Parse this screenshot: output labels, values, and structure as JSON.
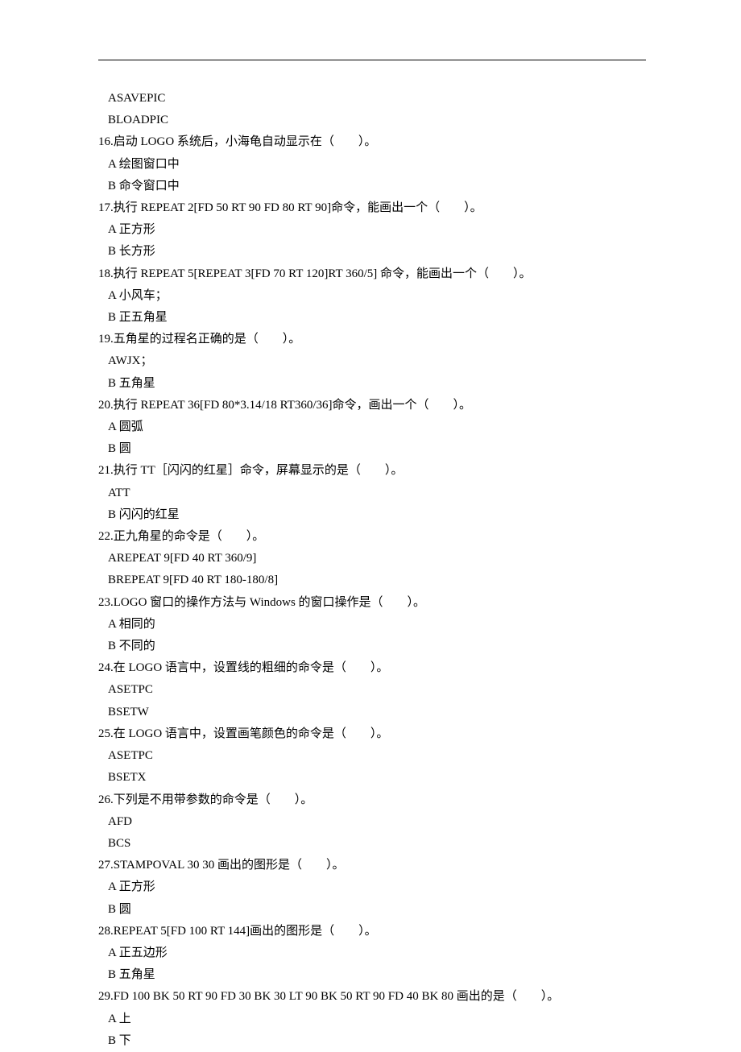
{
  "leadingOptions": [
    "ASAVEPIC",
    "BLOADPIC"
  ],
  "questions": [
    {
      "num": "16",
      "text": "启动 LOGO 系统后，小海龟自动显示在（　　）。",
      "options": [
        "A 绘图窗口中",
        "B 命令窗口中"
      ]
    },
    {
      "num": "17",
      "text": "执行 REPEAT 2[FD 50 RT 90 FD 80 RT 90]命令，能画出一个（　　）。",
      "options": [
        "A 正方形",
        "B 长方形"
      ]
    },
    {
      "num": "18",
      "text": "执行 REPEAT 5[REPEAT 3[FD 70 RT 120]RT 360/5]  命令，能画出一个（　　）。",
      "options": [
        "A 小风车；",
        "B 正五角星"
      ]
    },
    {
      "num": "19",
      "text": "五角星的过程名正确的是（　　）。",
      "options": [
        "AWJX；",
        "B 五角星"
      ]
    },
    {
      "num": "20",
      "text": "执行 REPEAT 36[FD 80*3.14/18 RT360/36]命令，画出一个（　　）。",
      "options": [
        "A 圆弧",
        "B 圆"
      ]
    },
    {
      "num": "21",
      "text": "执行 TT［闪闪的红星］命令，屏幕显示的是（　　）。",
      "options": [
        "ATT",
        "B 闪闪的红星"
      ]
    },
    {
      "num": "22",
      "text": "正九角星的命令是（　　）。",
      "options": [
        "AREPEAT 9[FD 40 RT 360/9]",
        "BREPEAT 9[FD 40 RT 180-180/8]"
      ]
    },
    {
      "num": "23",
      "text": "LOGO 窗口的操作方法与 Windows 的窗口操作是（　　）。",
      "options": [
        "A 相同的",
        "B 不同的"
      ]
    },
    {
      "num": "24",
      "text": "在 LOGO 语言中，设置线的粗细的命令是（　　）。",
      "options": [
        "ASETPC",
        "BSETW"
      ]
    },
    {
      "num": "25",
      "text": "在 LOGO 语言中，设置画笔颜色的命令是（　　）。",
      "options": [
        "ASETPC",
        "BSETX"
      ]
    },
    {
      "num": "26",
      "text": "下列是不用带参数的命令是（　　）。",
      "options": [
        "AFD",
        "BCS"
      ]
    },
    {
      "num": "27",
      "text": "STAMPOVAL 30 30 画出的图形是（　　）。",
      "options": [
        "A 正方形",
        "B 圆"
      ]
    },
    {
      "num": "28",
      "text": "REPEAT 5[FD 100 RT 144]画出的图形是（　　）。",
      "options": [
        "A 正五边形",
        "B 五角星"
      ]
    },
    {
      "num": "29",
      "text": "FD 100 BK 50 RT 90 FD 30 BK 30 LT 90 BK 50 RT 90 FD 40 BK 80 画出的是（　　）。",
      "options": [
        "A 上",
        "B 下"
      ]
    }
  ]
}
